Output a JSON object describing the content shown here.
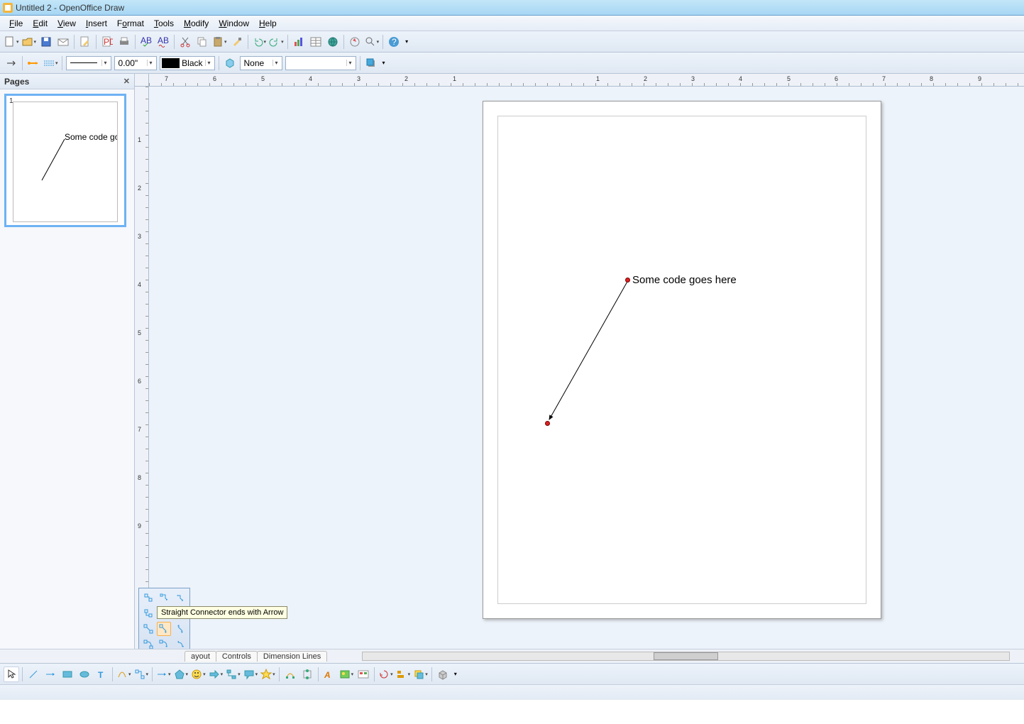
{
  "window": {
    "title": "Untitled 2 - OpenOffice Draw"
  },
  "menu": {
    "file": "File",
    "edit": "Edit",
    "view": "View",
    "insert": "Insert",
    "format": "Format",
    "tools": "Tools",
    "modify": "Modify",
    "window": "Window",
    "help": "Help"
  },
  "toolbar2": {
    "line_width": "0.00\"",
    "color_name": "Black",
    "area_fill": "None"
  },
  "pages_panel": {
    "title": "Pages",
    "page_number": "1"
  },
  "canvas": {
    "text": "Some code goes here"
  },
  "tooltip": "Straight Connector ends with Arrow",
  "tabs": {
    "layout": "ayout",
    "controls": "Controls",
    "dimlines": "Dimension Lines"
  },
  "ruler_h": [
    "7",
    "6",
    "5",
    "4",
    "3",
    "2",
    "1",
    "1",
    "2",
    "3",
    "4",
    "5",
    "6",
    "7",
    "8",
    "9"
  ],
  "ruler_v": [
    "1",
    "2",
    "3",
    "4",
    "5",
    "6",
    "7",
    "8",
    "9"
  ]
}
